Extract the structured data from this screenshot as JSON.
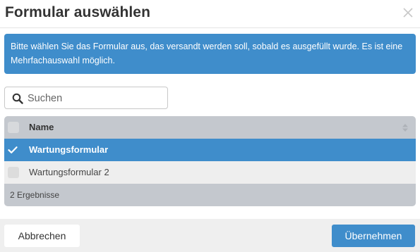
{
  "dialog": {
    "title": "Formular auswählen",
    "close_icon": "close-icon"
  },
  "info": {
    "text": "Bitte wählen Sie das Formular aus, das versandt werden soll, sobald es ausgefüllt wurde. Es ist eine Mehrfachauswahl möglich."
  },
  "search": {
    "placeholder": "Suchen",
    "value": "",
    "icon": "search-icon"
  },
  "table": {
    "columns": [
      "Name"
    ],
    "rows": [
      {
        "name": "Wartungsformular",
        "selected": true
      },
      {
        "name": "Wartungsformular 2",
        "selected": false
      }
    ],
    "result_count": "2 Ergebnisse"
  },
  "buttons": {
    "cancel": "Abbrechen",
    "confirm": "Übernehmen"
  },
  "colors": {
    "accent": "#3f8dcb",
    "header_row": "#c4c8ce",
    "footer_bg": "#efefef"
  }
}
